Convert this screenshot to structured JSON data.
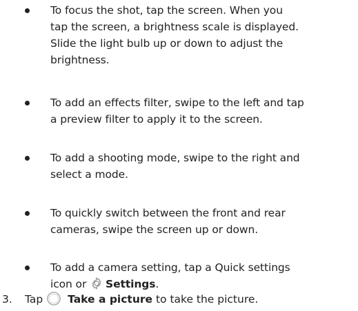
{
  "bullets": [
    {
      "line1": "To focus the shot, tap the screen. When you",
      "line2": "tap the screen, a brightness scale is displayed.",
      "line3": "Slide the light bulb up or down to adjust the",
      "line4": "brightness."
    },
    {
      "line1": "To add an effects filter, swipe to the left and tap",
      "line2": "a preview filter to apply it to the screen."
    },
    {
      "line1": "To add a shooting mode, swipe to the right and",
      "line2": "select a mode."
    },
    {
      "line1": "To quickly switch between the front and rear",
      "line2": "cameras, swipe the screen up or down."
    },
    {
      "line1": "To add a camera setting, tap a Quick settings",
      "line2_prefix": "icon or",
      "line2_bold": "Settings",
      "line2_suffix": "."
    }
  ],
  "step": {
    "number": "3.",
    "prefix": "Tap",
    "bold": "Take a picture",
    "suffix": "to take the picture."
  },
  "icons": {
    "gear": "gear-icon",
    "shutter": "shutter-icon"
  },
  "colors": {
    "text": "#222222",
    "background": "#ffffff",
    "icon_stroke": "#8a8a8a"
  }
}
